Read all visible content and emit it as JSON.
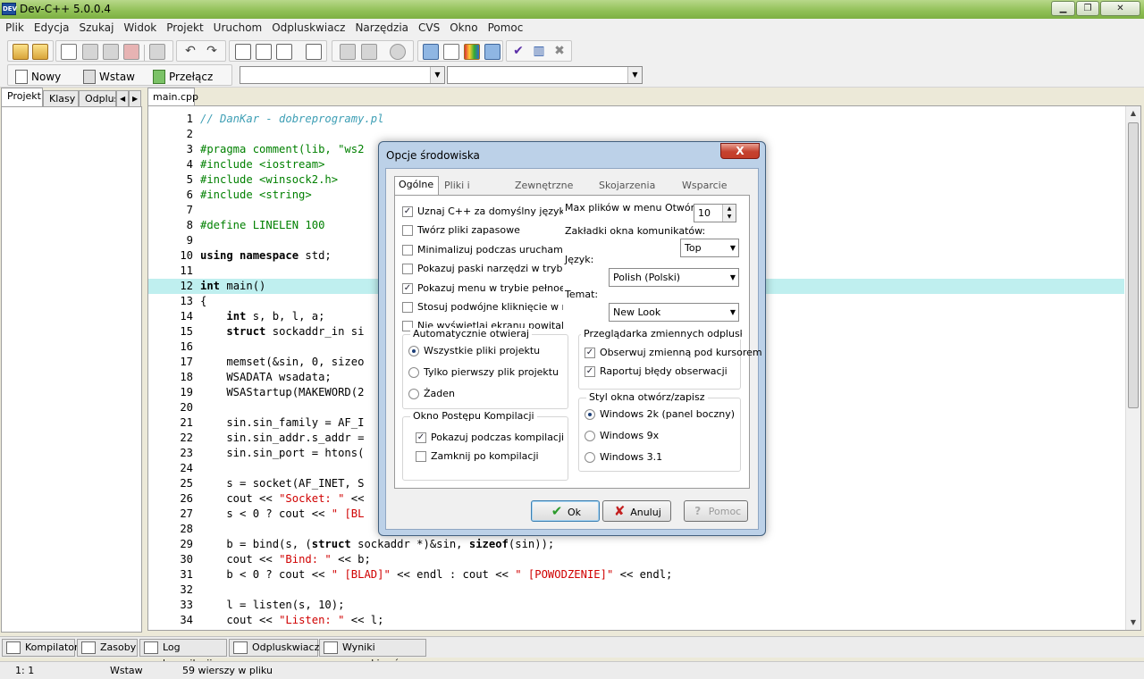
{
  "window": {
    "title": "Dev-C++ 5.0.0.4",
    "app_icon_text": "DEV"
  },
  "window_buttons": {
    "minimize": "▁",
    "maximize": "❐",
    "close": "✕"
  },
  "menu": [
    "Plik",
    "Edycja",
    "Szukaj",
    "Widok",
    "Projekt",
    "Uruchom",
    "Odpluskwiacz",
    "Narzędzia",
    "CVS",
    "Okno",
    "Pomoc"
  ],
  "toolbar2": {
    "new_label": "Nowy",
    "insert_label": "Wstaw",
    "toggle_label": "Przełącz"
  },
  "left_tabs": [
    "Projekt",
    "Klasy",
    "Odplus"
  ],
  "editor_tab": "main.cpp",
  "code": [
    {
      "n": "1",
      "t": "// DanKar - dobreprogramy.pl"
    },
    {
      "n": "2",
      "t": ""
    },
    {
      "n": "3",
      "t": "#pragma comment(lib, \"ws2"
    },
    {
      "n": "4",
      "t": "#include <iostream>"
    },
    {
      "n": "5",
      "t": "#include <winsock2.h>"
    },
    {
      "n": "6",
      "t": "#include <string>"
    },
    {
      "n": "7",
      "t": ""
    },
    {
      "n": "8",
      "t": "#define LINELEN 100"
    },
    {
      "n": "9",
      "t": ""
    },
    {
      "n": "10",
      "t": "using namespace std;"
    },
    {
      "n": "11",
      "t": ""
    },
    {
      "n": "12",
      "t": "int main()"
    },
    {
      "n": "13",
      "t": "{"
    },
    {
      "n": "14",
      "t": "    int s, b, l, a;"
    },
    {
      "n": "15",
      "t": "    struct sockaddr_in si"
    },
    {
      "n": "16",
      "t": ""
    },
    {
      "n": "17",
      "t": "    memset(&sin, 0, sizeo"
    },
    {
      "n": "18",
      "t": "    WSADATA wsadata;"
    },
    {
      "n": "19",
      "t": "    WSAStartup(MAKEWORD(2"
    },
    {
      "n": "20",
      "t": ""
    },
    {
      "n": "21",
      "t": "    sin.sin_family = AF_I"
    },
    {
      "n": "22",
      "t": "    sin.sin_addr.s_addr ="
    },
    {
      "n": "23",
      "t": "    sin.sin_port = htons("
    },
    {
      "n": "24",
      "t": ""
    },
    {
      "n": "25",
      "t": "    s = socket(AF_INET, S"
    },
    {
      "n": "26",
      "t": "    cout << \"Socket: \" <<"
    },
    {
      "n": "27",
      "t": "    s < 0 ? cout << \" [BL"
    },
    {
      "n": "28",
      "t": ""
    },
    {
      "n": "29",
      "t": "    b = bind(s, (struct sockaddr *)&sin, sizeof(sin));"
    },
    {
      "n": "30",
      "t": "    cout << \"Bind: \" << b;"
    },
    {
      "n": "31",
      "t": "    b < 0 ? cout << \" [BLAD]\" << endl : cout << \" [POWODZENIE]\" << endl;"
    },
    {
      "n": "32",
      "t": ""
    },
    {
      "n": "33",
      "t": "    l = listen(s, 10);"
    },
    {
      "n": "34",
      "t": "    cout << \"Listen: \" << l;"
    }
  ],
  "bottom_tabs": [
    "Kompilator",
    "Zasoby",
    "Log kompilacji",
    "Odpluskwiacz",
    "Wyniki poszukiwań"
  ],
  "status": {
    "position": "1: 1",
    "mode": "Wstaw",
    "lines": "59 wierszy w pliku"
  },
  "dialog": {
    "title": "Opcje środowiska",
    "close_glyph": "X",
    "tabs": [
      "Ogólne",
      "Pliki i katalogi",
      "Zewnętrzne pr...",
      "Skojarzenia pli...",
      "Wsparcie CVS"
    ],
    "checkboxes": [
      {
        "label": "Uznaj C++ za domyślny język nowy",
        "checked": true
      },
      {
        "label": "Twórz pliki zapasowe",
        "checked": false
      },
      {
        "label": "Minimalizuj podczas uruchamiani",
        "checked": false
      },
      {
        "label": "Pokazuj paski narzędzi w trybie p",
        "checked": false
      },
      {
        "label": "Pokazuj menu w trybie pełnoekr",
        "checked": true
      },
      {
        "label": "Stosuj podwójne kliknięcie w menu",
        "checked": false
      },
      {
        "label": "Nie wyświetlaj ekranu powitalneg",
        "checked": false
      }
    ],
    "max_files_label": "Max plików w menu Otwórz P",
    "max_files_value": "10",
    "msg_tabs_label": "Zakładki okna komunikatów:",
    "msg_tabs_value": "Top",
    "language_label": "Język:",
    "language_value": "Polish (Polski)",
    "theme_label": "Temat:",
    "theme_value": "New Look",
    "auto_open": {
      "title": "Automatycznie otwieraj",
      "options": [
        {
          "label": "Wszystkie pliki projektu",
          "selected": true
        },
        {
          "label": "Tylko pierwszy plik projektu",
          "selected": false
        },
        {
          "label": "Żaden",
          "selected": false
        }
      ]
    },
    "debug_viewer": {
      "title": "Przeglądarka zmiennych odpluskwiac",
      "options": [
        {
          "label": "Obserwuj zmienną pod kursorem",
          "checked": true
        },
        {
          "label": "Raportuj błędy obserwacji",
          "checked": true
        }
      ]
    },
    "compile_progress": {
      "title": "Okno Postępu Kompilacji",
      "options": [
        {
          "label": "Pokazuj podczas kompilacji",
          "checked": true
        },
        {
          "label": "Zamknij po kompilacji",
          "checked": false
        }
      ]
    },
    "open_style": {
      "title": "Styl okna otwórz/zapisz",
      "options": [
        {
          "label": "Windows 2k (panel boczny)",
          "selected": true
        },
        {
          "label": "Windows 9x",
          "selected": false
        },
        {
          "label": "Windows 3.1",
          "selected": false
        }
      ]
    },
    "buttons": {
      "ok": "Ok",
      "cancel": "Anuluj",
      "help": "Pomoc"
    }
  }
}
